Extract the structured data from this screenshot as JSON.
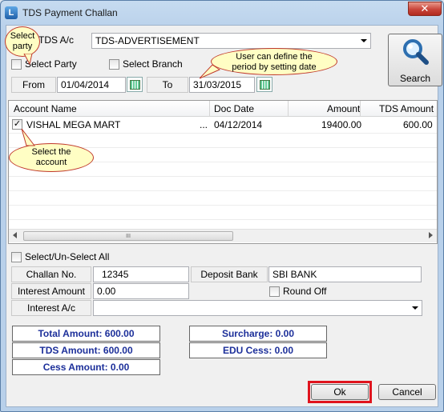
{
  "window": {
    "title": "TDS Payment Challan",
    "close_glyph": "✕",
    "app_icon_glyph": "L"
  },
  "tds": {
    "label": "TDS A/c",
    "value": "TDS-ADVERTISEMENT"
  },
  "filters": {
    "select_party": "Select Party",
    "select_branch": "Select Branch"
  },
  "period": {
    "from_label": "From",
    "from_value": "01/04/2014",
    "to_label": "To",
    "to_value": "31/03/2015"
  },
  "search": {
    "label": "Search"
  },
  "grid": {
    "columns": [
      "Account Name",
      "Doc Date",
      "Amount",
      "TDS Amount"
    ],
    "rows": [
      {
        "checked": "✓",
        "account": "VISHAL MEGA MART",
        "ellipsis": "...",
        "doc_date": "04/12/2014",
        "amount": "19400.00",
        "tds_amount": "600.00"
      }
    ],
    "scroll_grip": "III"
  },
  "select_all": {
    "label": "Select/Un-Select All"
  },
  "challan": {
    "label": "Challan No.",
    "value": "12345"
  },
  "deposit_bank": {
    "label": "Deposit Bank",
    "value": "SBI BANK"
  },
  "interest_amount": {
    "label": "Interest Amount",
    "value": "0.00"
  },
  "round_off": {
    "label": "Round Off"
  },
  "interest_ac": {
    "label": "Interest A/c",
    "value": ""
  },
  "totals": {
    "total_amount": "Total Amount: 600.00",
    "surcharge": "Surcharge: 0.00",
    "tds_amount": "TDS Amount: 600.00",
    "edu_cess": "EDU Cess: 0.00",
    "cess_amount": "Cess Amount: 0.00"
  },
  "buttons": {
    "ok": "Ok",
    "cancel": "Cancel"
  },
  "callouts": {
    "select_party": "Select party",
    "period": "User can define the period by setting date",
    "account": "Select the account"
  },
  "colors": {
    "totals_text": "#1c2f9a",
    "highlight": "#e0141e",
    "callout_bg": "#fffec4"
  }
}
